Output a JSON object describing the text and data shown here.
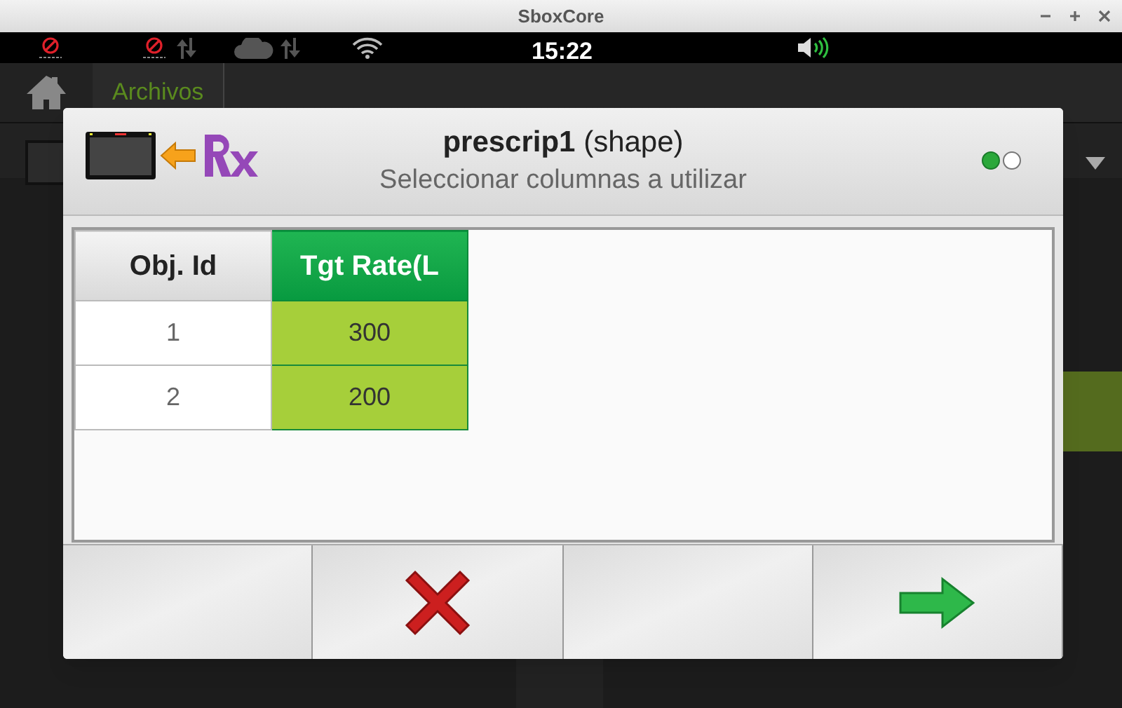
{
  "window": {
    "title": "SboxCore"
  },
  "status_bar": {
    "time": "15:22"
  },
  "breadcrumb": {
    "items": [
      {
        "label": "Archivos"
      }
    ]
  },
  "dialog": {
    "title": "**prescrip1** (shape)",
    "subtitle": "Seleccionar columnas a utilizar",
    "pages": [
      {
        "selected": true
      },
      {
        "selected": false
      }
    ],
    "table": {
      "columns": [
        {
          "label": "Obj. Id",
          "selected": false
        },
        {
          "label": "Tgt Rate(L",
          "selected": true
        }
      ],
      "rows": [
        [
          "1",
          "300"
        ],
        [
          "2",
          "200"
        ]
      ]
    },
    "buttons": [
      {
        "kind": "empty"
      },
      {
        "kind": "cancel"
      },
      {
        "kind": "empty"
      },
      {
        "kind": "next"
      }
    ]
  }
}
